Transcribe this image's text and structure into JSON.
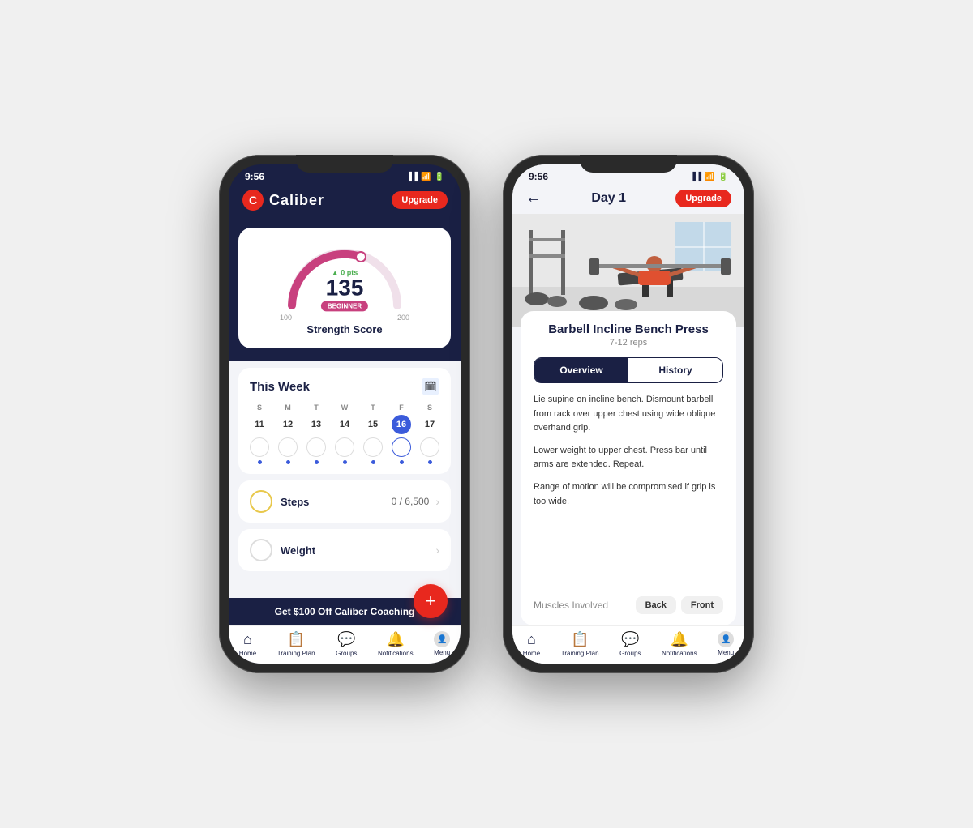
{
  "app": {
    "name": "Caliber",
    "status_time": "9:56"
  },
  "phone1": {
    "status_time": "9:56",
    "upgrade_label": "Upgrade",
    "strength_card": {
      "pts_label": "▲ 0 pts",
      "score": "135",
      "badge": "BEGINNER",
      "label_min": "100",
      "label_max": "200",
      "title": "Strength Score"
    },
    "this_week": {
      "title": "This Week",
      "days": [
        "S",
        "M",
        "T",
        "W",
        "T",
        "F",
        "S"
      ],
      "dates": [
        "11",
        "12",
        "13",
        "14",
        "15",
        "16",
        "17"
      ],
      "today_index": 5
    },
    "steps": {
      "label": "Steps",
      "value": "0 / 6,500"
    },
    "weight": {
      "label": "Weight"
    },
    "promo": "Get $100 Off Caliber Coaching",
    "nav": {
      "items": [
        "Home",
        "Training Plan",
        "Groups",
        "Notifications",
        "Menu"
      ]
    }
  },
  "phone2": {
    "status_time": "9:56",
    "upgrade_label": "Upgrade",
    "day_title": "Day 1",
    "exercise": {
      "name": "Barbell Incline Bench Press",
      "reps": "7-12 reps",
      "tab_overview": "Overview",
      "tab_history": "History",
      "desc1": "Lie supine on incline bench. Dismount barbell from rack over upper chest using wide oblique overhand grip.",
      "desc2": "Lower weight to upper chest. Press bar until arms are extended. Repeat.",
      "desc3": "Range of motion will be compromised if grip is too wide.",
      "muscles_label": "Muscles Involved",
      "btn_back": "Back",
      "btn_front": "Front"
    },
    "nav": {
      "items": [
        "Home",
        "Training Plan",
        "Groups",
        "Notifications",
        "Menu"
      ]
    }
  }
}
